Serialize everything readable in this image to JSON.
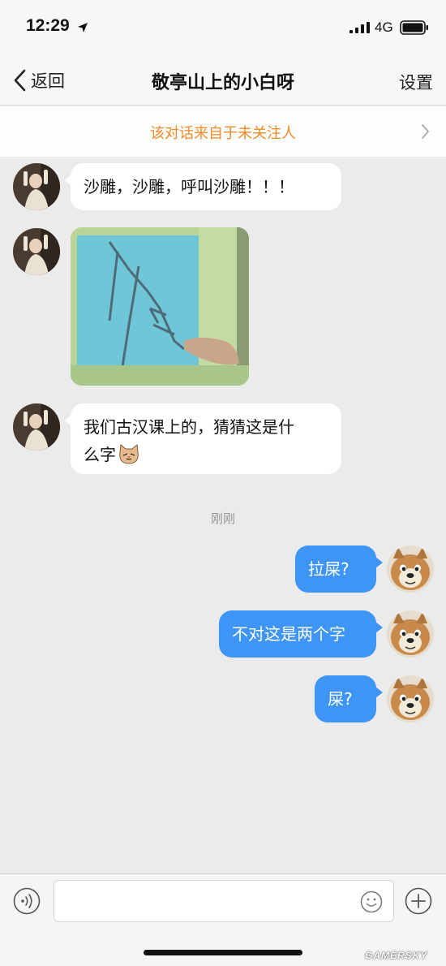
{
  "status_bar": {
    "time": "12:29",
    "network": "4G",
    "location_icon": "location-arrow-icon",
    "signal_icon": "cellular-signal-icon",
    "battery_icon": "battery-icon"
  },
  "nav": {
    "back_label": "返回",
    "title": "敬亭山上的小白呀",
    "settings_label": "设置"
  },
  "notice": {
    "text": "该对话来自于未关注人",
    "color": "#f08a25"
  },
  "messages": [
    {
      "side": "in",
      "text": "沙雕，沙雕，呼叫沙雕！！！"
    },
    {
      "side": "in",
      "type": "image",
      "description_icon": "photo-handwriting-icon"
    },
    {
      "side": "in",
      "text_line1": "我们古汉课上的，猜猜这是什",
      "text_line2": "么字",
      "emoji_icon": "cat-face-emoji-icon"
    },
    {
      "side": "out",
      "text": "拉屎?"
    },
    {
      "side": "out",
      "text": "不对这是两个字"
    },
    {
      "side": "out",
      "text": "屎?"
    }
  ],
  "time_divider": "刚刚",
  "input": {
    "value": "",
    "placeholder": ""
  },
  "colors": {
    "outgoing_bubble": "#3e95f5",
    "incoming_bubble": "#ffffff",
    "background": "#ebebeb"
  },
  "watermark": "GAMERSKY"
}
